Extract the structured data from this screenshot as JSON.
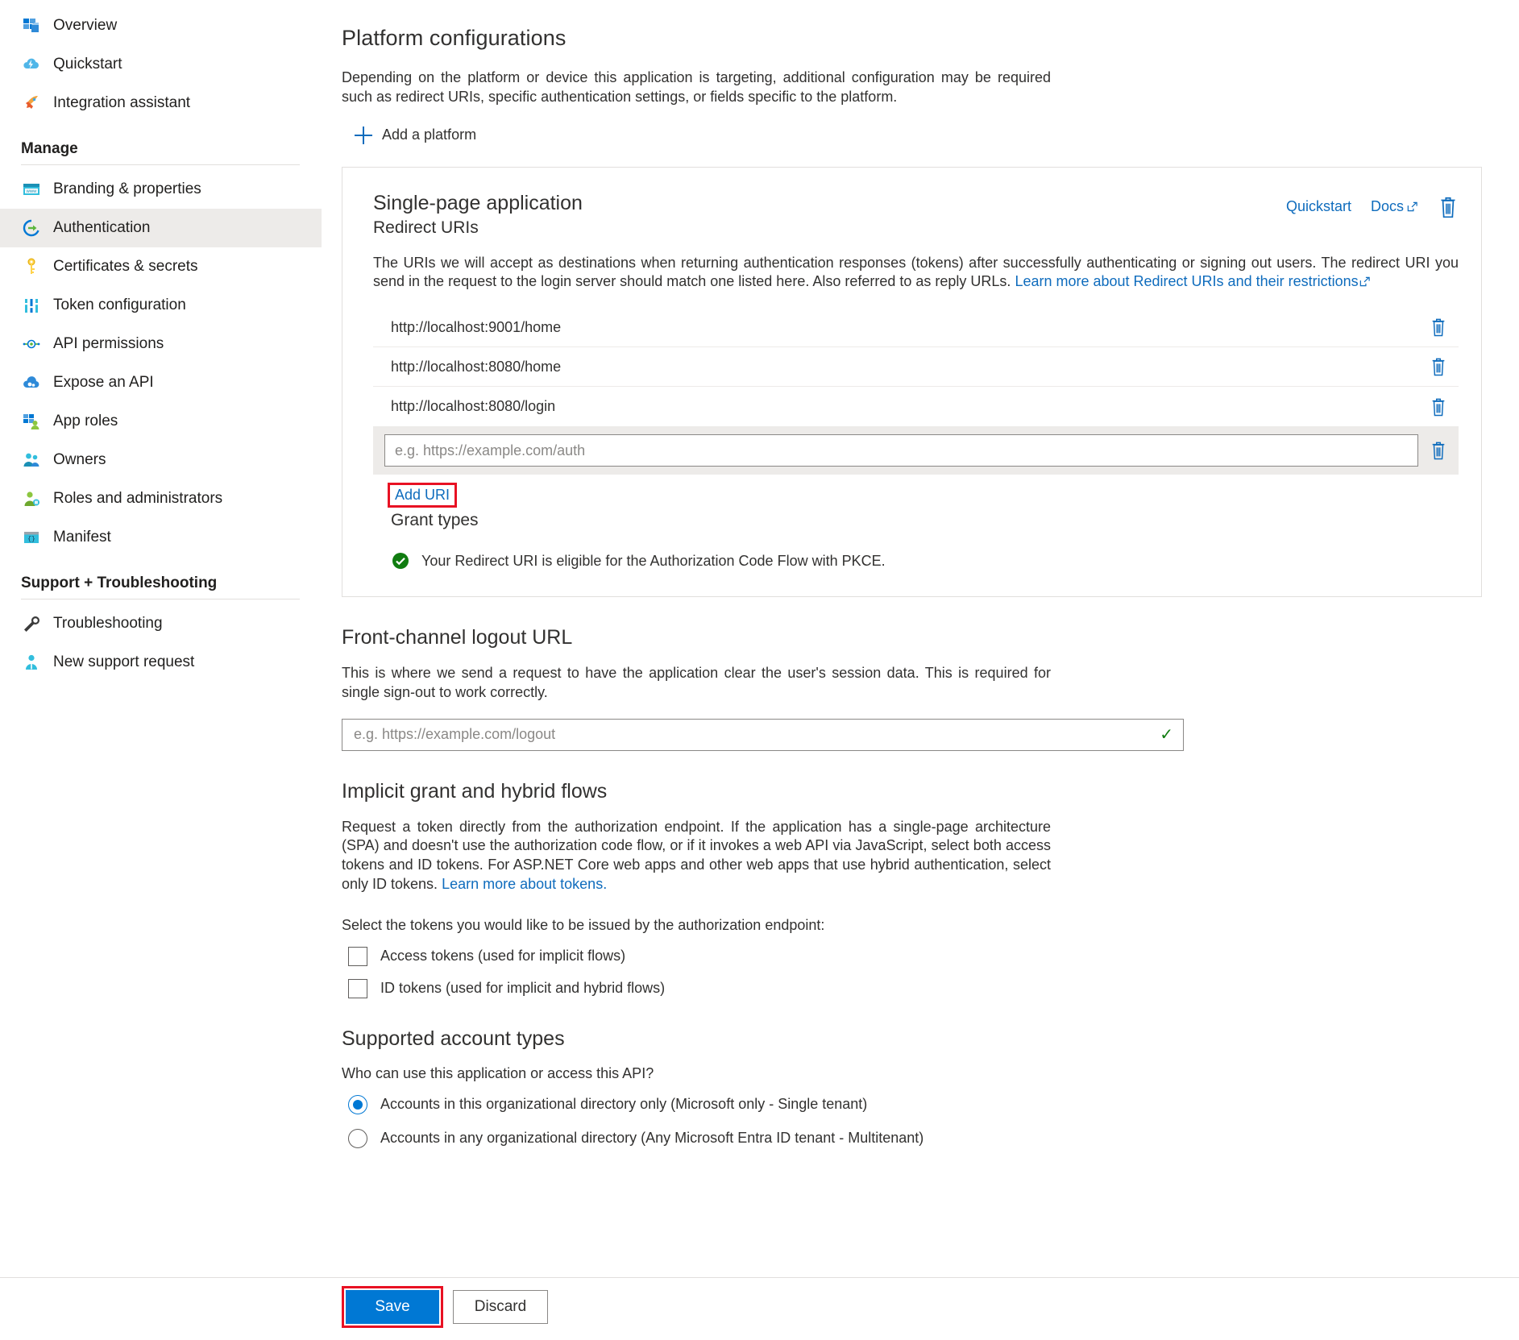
{
  "sidebar": {
    "top_items": [
      {
        "label": "Overview",
        "icon": "overview-grid-icon"
      },
      {
        "label": "Quickstart",
        "icon": "quickstart-cloud-lightning-icon"
      },
      {
        "label": "Integration assistant",
        "icon": "rocket-icon"
      }
    ],
    "groups": [
      {
        "title": "Manage",
        "items": [
          {
            "label": "Branding & properties",
            "icon": "branding-window-icon",
            "selected": false
          },
          {
            "label": "Authentication",
            "icon": "authentication-arrow-icon",
            "selected": true
          },
          {
            "label": "Certificates & secrets",
            "icon": "key-icon",
            "selected": false
          },
          {
            "label": "Token configuration",
            "icon": "token-bars-icon",
            "selected": false
          },
          {
            "label": "API permissions",
            "icon": "api-permissions-icon",
            "selected": false
          },
          {
            "label": "Expose an API",
            "icon": "expose-api-cloud-icon",
            "selected": false
          },
          {
            "label": "App roles",
            "icon": "app-roles-grid-person-icon",
            "selected": false
          },
          {
            "label": "Owners",
            "icon": "owners-people-icon",
            "selected": false
          },
          {
            "label": "Roles and administrators",
            "icon": "roles-admin-person-icon",
            "selected": false
          },
          {
            "label": "Manifest",
            "icon": "manifest-braces-icon",
            "selected": false
          }
        ]
      },
      {
        "title": "Support + Troubleshooting",
        "items": [
          {
            "label": "Troubleshooting",
            "icon": "wrench-icon",
            "selected": false
          },
          {
            "label": "New support request",
            "icon": "support-person-icon",
            "selected": false
          }
        ]
      }
    ]
  },
  "main": {
    "platform_section": {
      "title": "Platform configurations",
      "description": "Depending on the platform or device this application is targeting, additional configuration may be required such as redirect URIs, specific authentication settings, or fields specific to the platform.",
      "add_platform_label": "Add a platform"
    },
    "platform_card": {
      "title": "Single-page application",
      "subtitle": "Redirect URIs",
      "quickstart_label": "Quickstart",
      "docs_label": "Docs",
      "description_part1": "The URIs we will accept as destinations when returning authentication responses (tokens) after successfully authenticating or signing out users. The redirect URI you send in the request to the login server should match one listed here. Also referred to as reply URLs. ",
      "description_link": "Learn more about Redirect URIs and their restrictions",
      "redirect_uris": [
        "http://localhost:9001/home",
        "http://localhost:8080/home",
        "http://localhost:8080/login"
      ],
      "new_uri_placeholder": "e.g. https://example.com/auth",
      "new_uri_value": "",
      "add_uri_label": "Add URI",
      "grant_types_title": "Grant types",
      "grant_types_status": "Your Redirect URI is eligible for the Authorization Code Flow with PKCE."
    },
    "logout_section": {
      "title": "Front-channel logout URL",
      "description": "This is where we send a request to have the application clear the user's session data. This is required for single sign-out to work correctly.",
      "placeholder": "e.g. https://example.com/logout",
      "value": ""
    },
    "implicit_section": {
      "title": "Implicit grant and hybrid flows",
      "description_part1": "Request a token directly from the authorization endpoint. If the application has a single-page architecture (SPA) and doesn't use the authorization code flow, or if it invokes a web API via JavaScript, select both access tokens and ID tokens. For ASP.NET Core web apps and other web apps that use hybrid authentication, select only ID tokens. ",
      "description_link": "Learn more about tokens.",
      "select_label": "Select the tokens you would like to be issued by the authorization endpoint:",
      "checkboxes": [
        {
          "label": "Access tokens (used for implicit flows)",
          "checked": false
        },
        {
          "label": "ID tokens (used for implicit and hybrid flows)",
          "checked": false
        }
      ]
    },
    "account_types_section": {
      "title": "Supported account types",
      "question": "Who can use this application or access this API?",
      "options": [
        {
          "label": "Accounts in this organizational directory only (Microsoft only - Single tenant)",
          "selected": true
        },
        {
          "label": "Accounts in any organizational directory (Any Microsoft Entra ID tenant - Multitenant)",
          "selected": false
        }
      ]
    }
  },
  "bottom_bar": {
    "save_label": "Save",
    "discard_label": "Discard"
  },
  "colors": {
    "accent": "#0078d4",
    "link": "#0f6cbd",
    "highlight": "#e81123",
    "success": "#107c10",
    "selected_bg": "#edebe9"
  }
}
